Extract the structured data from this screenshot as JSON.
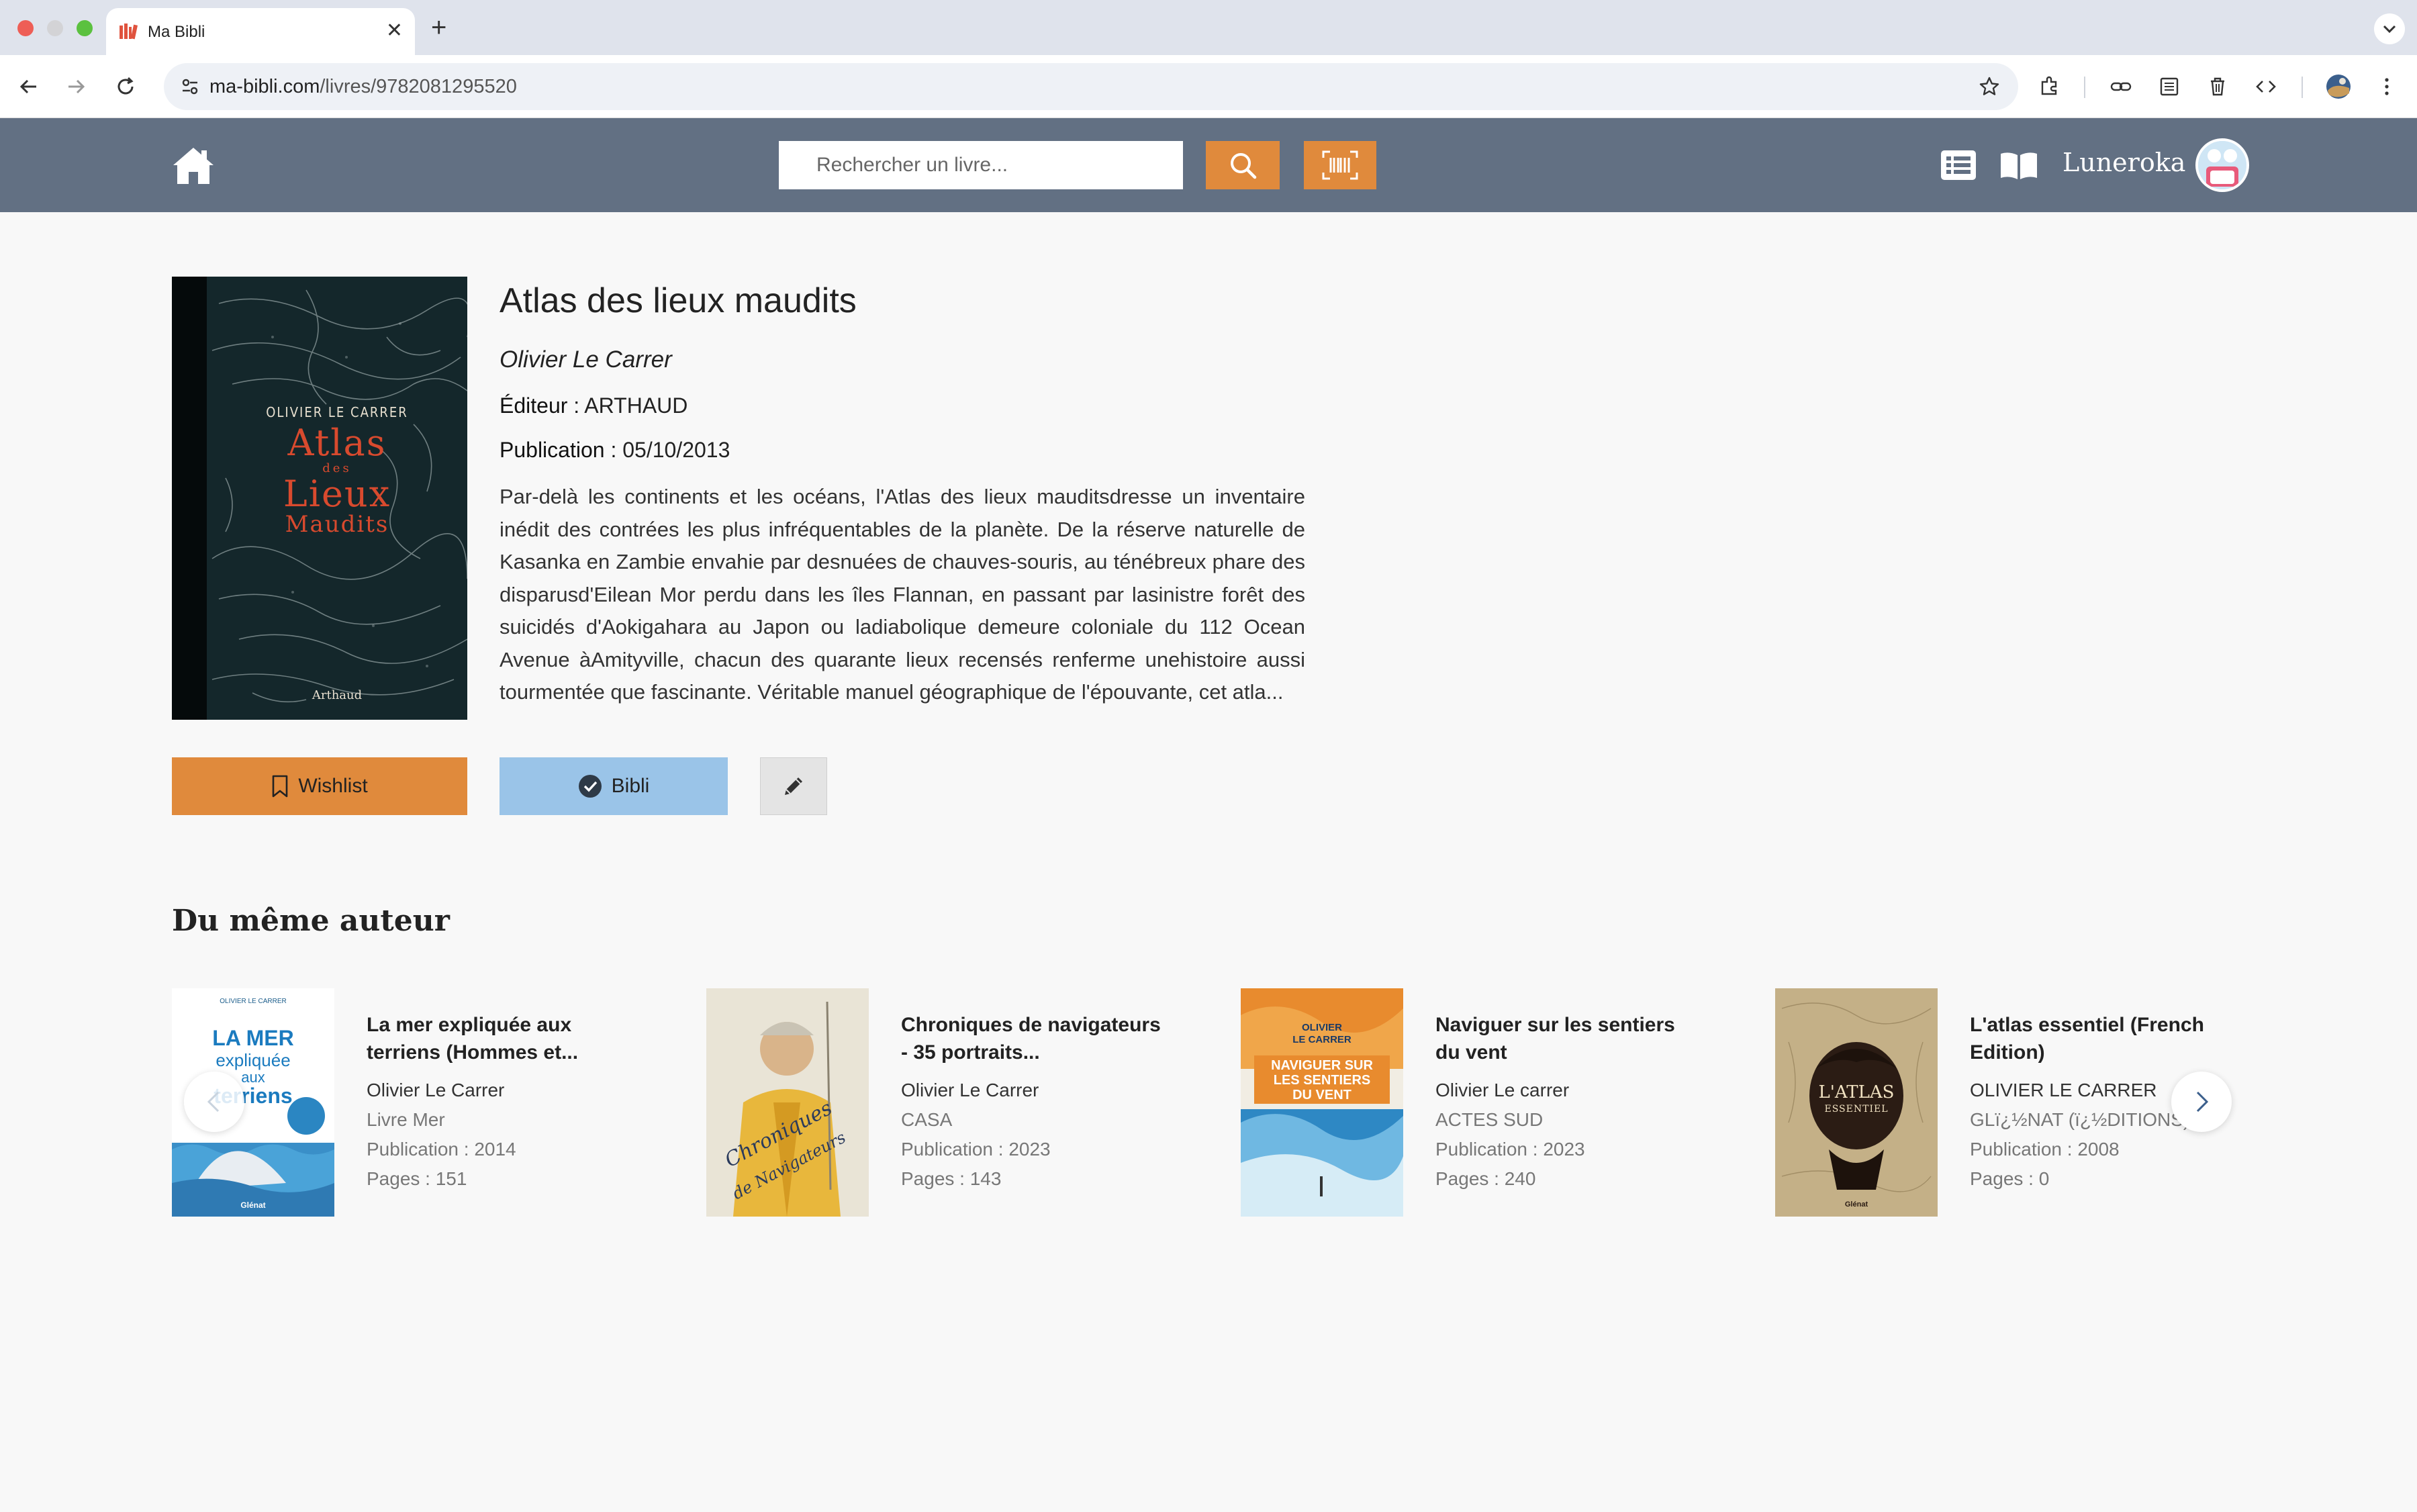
{
  "browser": {
    "tab_title": "Ma Bibli",
    "url_host": "ma-bibli.com",
    "url_path": "/livres/9782081295520"
  },
  "header": {
    "search_placeholder": "Rechercher un livre...",
    "username": "Luneroka",
    "accent_color": "#e08a3c",
    "bar_color": "#627083"
  },
  "book": {
    "cover": {
      "author": "OLIVIER LE CARRER",
      "title_line1": "Atlas",
      "title_line2": "des",
      "title_line3": "Lieux",
      "title_line4": "Maudits",
      "publisher": "Arthaud"
    },
    "title": "Atlas des lieux maudits",
    "author": "Olivier Le Carrer",
    "editor_label": "Éditeur :",
    "editor": "ARTHAUD",
    "publication_label": "Publication :",
    "publication": "05/10/2013",
    "description": "Par-delà les continents et les océans, l'Atlas des lieux mauditsdresse un inventaire inédit des contrées les plus infréquentables de la planète. De la réserve naturelle de Kasanka en Zambie envahie par desnuées de chauves-souris, au ténébreux phare des disparusd'Eilean Mor perdu dans les îles Flannan, en passant par lasinistre forêt des suicidés d'Aokigahara au Japon ou ladiabolique demeure coloniale du 112 Ocean Avenue àAmityville, chacun des quarante lieux recensés renferme unehistoire aussi tourmentée que fascinante. Véritable manuel géographique de l'épouvante, cet atla..."
  },
  "actions": {
    "wishlist_label": "Wishlist",
    "bibli_label": "Bibli"
  },
  "same_author": {
    "section_title": "Du même auteur",
    "books": [
      {
        "title": "La mer expliquée aux terriens (Hommes et...",
        "author": "Olivier Le Carrer",
        "line1": "Livre Mer",
        "line2": "Publication : 2014",
        "line3": "Pages : 151",
        "cover_top": "OLIVIER LE CARRER",
        "cover_text1": "LA MER",
        "cover_text2": "expliquée",
        "cover_text3": "aux",
        "cover_text4": "terriens",
        "cover_pub": "Glénat"
      },
      {
        "title": "Chroniques de navigateurs - 35 portraits...",
        "author": "Olivier Le Carrer",
        "line1": "CASA",
        "line2": "Publication : 2023",
        "line3": "Pages : 143",
        "cover_text1": "Chroniques",
        "cover_text2": "de Navigateurs"
      },
      {
        "title": "Naviguer sur les sentiers du vent",
        "author": "Olivier Le carrer",
        "line1": "ACTES SUD",
        "line2": "Publication : 2023",
        "line3": "Pages : 240",
        "cover_top1": "OLIVIER",
        "cover_top2": "LE CARRER",
        "cover_text1": "NAVIGUER SUR",
        "cover_text2": "LES SENTIERS",
        "cover_text3": "DU VENT"
      },
      {
        "title": "L'atlas essentiel (French Edition)",
        "author": "OLIVIER LE CARRER",
        "line1": "GLï¿½NAT (ï¿½DITIONS)",
        "line2": "Publication : 2008",
        "line3": "Pages : 0",
        "cover_text1": "L'ATLAS",
        "cover_text2": "ESSENTIEL",
        "cover_pub": "Glénat"
      }
    ]
  }
}
